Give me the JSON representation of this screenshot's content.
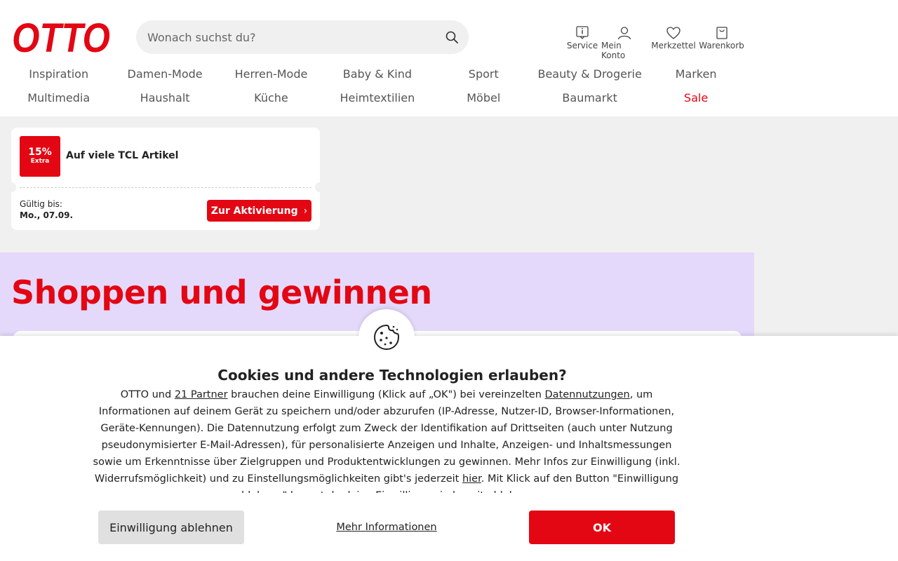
{
  "brand": {
    "logo_text": "OTTO",
    "color": "#e30613"
  },
  "search": {
    "placeholder": "Wonach suchst du?"
  },
  "service_nav": [
    {
      "label": "Service",
      "icon": "info-icon"
    },
    {
      "label": "Mein Konto",
      "icon": "user-icon"
    },
    {
      "label": "Merkzettel",
      "icon": "heart-icon"
    },
    {
      "label": "Warenkorb",
      "icon": "bag-icon"
    }
  ],
  "main_nav": {
    "row1": [
      "Inspiration",
      "Damen-Mode",
      "Herren-Mode",
      "Baby & Kind",
      "Sport",
      "Beauty & Drogerie",
      "Marken"
    ],
    "row2": [
      "Multimedia",
      "Haushalt",
      "Küche",
      "Heimtextilien",
      "Möbel",
      "Baumarkt",
      "Sale"
    ]
  },
  "coupon": {
    "badge_percent": "15%",
    "badge_extra": "Extra",
    "title": "Auf viele TCL Artikel",
    "valid_label": "Gültig bis:",
    "valid_date": "Mo., 07.09.",
    "button_label": "Zur Aktivierung"
  },
  "promo": {
    "title": "Shoppen und gewinnen",
    "background": "#e4d9fb"
  },
  "cookie_banner": {
    "title": "Cookies und andere Technologien erlauben?",
    "text_1": "OTTO und ",
    "link_partners": "21 Partner",
    "text_2": " brauchen deine Einwilligung (Klick auf „OK\") bei vereinzelten ",
    "link_datennutzungen": "Datennutzungen",
    "text_3": ", um Informationen auf deinem Gerät zu speichern und/oder abzurufen (IP-Adresse, Nutzer-ID, Browser-Informationen, Geräte-Kennungen). Die Datennutzung erfolgt zum Zweck der Identifikation auf Drittseiten (auch unter Nutzung pseudonymisierter E-Mail-Adressen), für personalisierte Anzeigen und Inhalte, Anzeigen- und Inhaltsmessungen sowie um Erkenntnisse über Zielgruppen und Produktentwicklungen zu gewinnen. Mehr Infos zur Einwilligung (inkl. Widerrufsmöglichkeit) und zu Einstellungsmöglichkeiten gibt's jederzeit ",
    "link_hier": "hier",
    "text_4": ". Mit Klick auf den Button \"Einwilligung ablehnen\" kannst du deine Einwilligung jederzeit ablehnen.",
    "decline_label": "Einwilligung ablehnen",
    "more_label": "Mehr Informationen",
    "ok_label": "OK"
  }
}
